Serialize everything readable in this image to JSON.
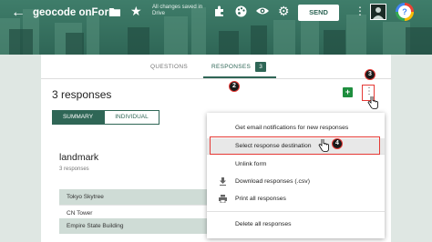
{
  "header": {
    "title": "geocode onForm:",
    "save_status": "All changes saved in Drive",
    "send_label": "SEND",
    "help_label": "?",
    "icons": [
      "back-arrow-icon",
      "folder-icon",
      "star-icon",
      "addon-icon",
      "palette-icon",
      "eye-icon",
      "gear-icon",
      "more-vert-icon"
    ],
    "colors": {
      "theme": "#2f6656",
      "annotation": "#e53935"
    }
  },
  "tabs": {
    "questions": "QUESTIONS",
    "responses": "RESPONSES",
    "responses_count": "3"
  },
  "responses": {
    "title": "3 responses",
    "sheets_icon_label": "+",
    "summary_label": "SUMMARY",
    "individual_label": "INDIVIDUAL"
  },
  "question": {
    "title": "landmark",
    "subtitle": "3 responses",
    "answers": [
      "Tokyo Skytree",
      "CN Tower",
      "Empire State Building"
    ]
  },
  "menu": {
    "items": [
      "Get email notifications for new responses",
      "Select response destination",
      "Unlink form",
      "Download responses (.csv)",
      "Print all responses",
      "Delete all responses"
    ]
  },
  "steps": {
    "s2": "2",
    "s3": "3",
    "s4": "4"
  }
}
